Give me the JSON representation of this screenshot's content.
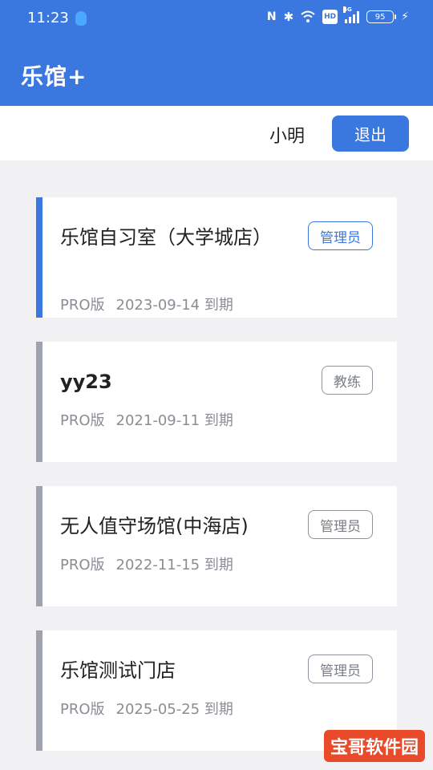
{
  "status_bar": {
    "time": "11:23",
    "nfc": "N",
    "bluetooth": "✱",
    "hd": "HD",
    "network": "4G",
    "battery": "95",
    "icons": [
      "qq-icon",
      "nfc-icon",
      "bluetooth-icon",
      "wifi-icon",
      "hd-icon",
      "signal-icon",
      "battery-icon",
      "charging-icon"
    ]
  },
  "header": {
    "title": "乐馆+"
  },
  "user": {
    "name": "小明",
    "logout_label": "退出"
  },
  "venues": [
    {
      "name": "乐馆自习室（大学城店）",
      "role": "管理员",
      "edition": "PRO版",
      "expiry": "2023-09-14 到期",
      "selected": true
    },
    {
      "name": "yy23",
      "role": "教练",
      "edition": "PRO版",
      "expiry": "2021-09-11 到期",
      "selected": false
    },
    {
      "name": "无人值守场馆(中海店)",
      "role": "管理员",
      "edition": "PRO版",
      "expiry": "2022-11-15 到期",
      "selected": false
    },
    {
      "name": "乐馆测试门店",
      "role": "管理员",
      "edition": "PRO版",
      "expiry": "2025-05-25 到期",
      "selected": false
    }
  ],
  "watermark": {
    "text": "宝哥软件园"
  },
  "colors": {
    "primary": "#3a78df",
    "inactive_bar": "#a0a3ad",
    "background": "#f1f1f3"
  }
}
